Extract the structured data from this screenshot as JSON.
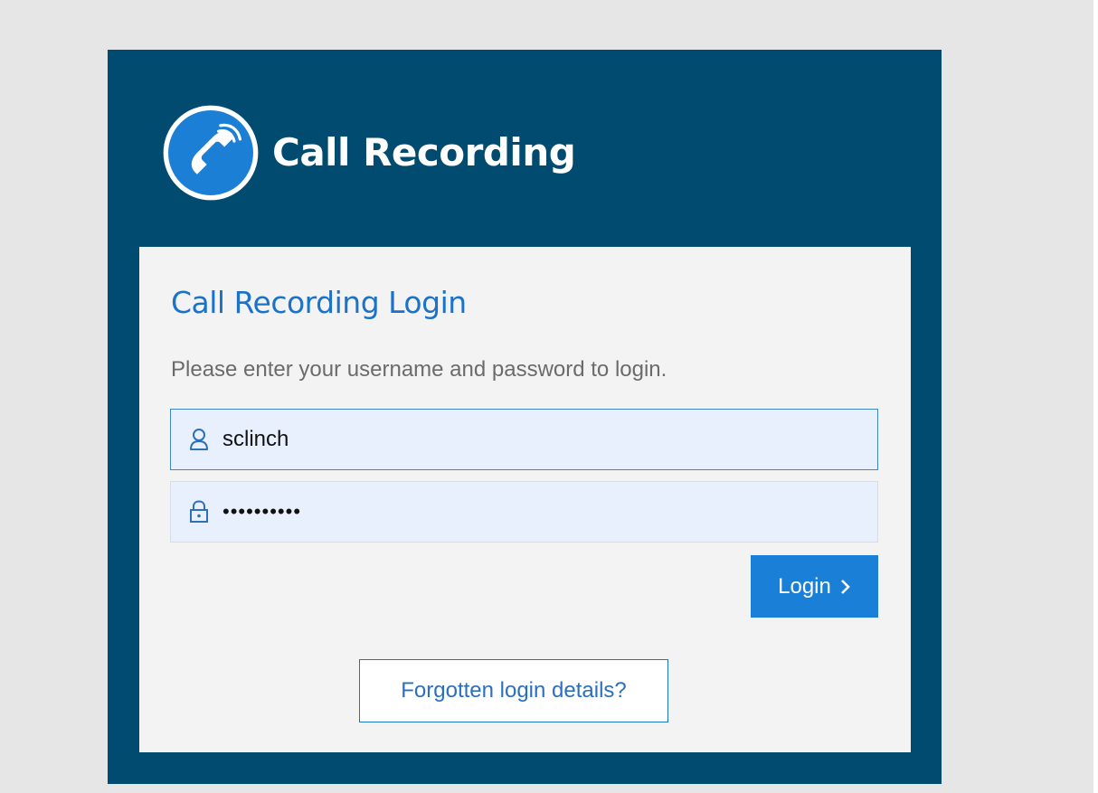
{
  "brand": {
    "name": "Call Recording",
    "logo_icon": "phone-handset-icon",
    "logo_color": "#1b7fd6"
  },
  "login": {
    "title": "Call Recording Login",
    "subtitle": "Please enter your username and password to login.",
    "username": {
      "icon": "user-icon",
      "value": "sclinch"
    },
    "password": {
      "icon": "lock-icon",
      "value": "••••••••••"
    },
    "submit_label": "Login",
    "submit_icon": "chevron-right-icon",
    "forgot_label": "Forgotten login details?"
  },
  "colors": {
    "page_background": "#e6e6e6",
    "panel_background": "#004b6f",
    "card_background": "#f3f3f3",
    "accent": "#1a7fd6",
    "title_text": "#1a73c9",
    "subtitle_text": "#6b6b6b",
    "input_background": "#e8f0fe"
  }
}
